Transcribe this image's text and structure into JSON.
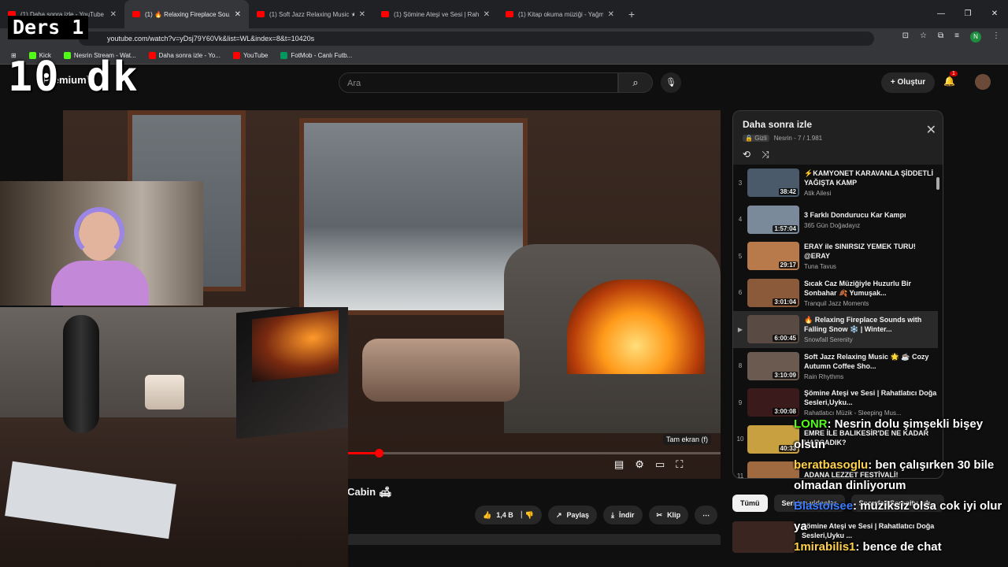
{
  "browser": {
    "tabs": [
      {
        "label": "(1) Daha sonra izle - YouTube",
        "active": false
      },
      {
        "label": "(1) 🔥 Relaxing Fireplace Sou...",
        "active": true
      },
      {
        "label": "(1) Soft Jazz Relaxing Music ★...",
        "active": false
      },
      {
        "label": "(1) Şömine Ateşi ve Sesi | Rahat...",
        "active": false
      },
      {
        "label": "(1) Kitap okuma müziği - Yağmu...",
        "active": false
      }
    ],
    "new_tab": "+",
    "url": "youtube.com/watch?v=yDsj79Y60Vk&list=WL&index=8&t=10420s",
    "profile_initial": "N",
    "bookmarks": [
      {
        "label": "Kick",
        "color": "#53fc18"
      },
      {
        "label": "Nesrin Stream - Wat...",
        "color": "#53fc18"
      },
      {
        "label": "Daha sonra izle - Yo...",
        "color": "#ff0000"
      },
      {
        "label": "YouTube",
        "color": "#ff0000"
      },
      {
        "label": "FotMob - Canlı Futb...",
        "color": "#00985f"
      }
    ]
  },
  "youtube": {
    "logo": "Premium",
    "logo_region": "TR",
    "search_placeholder": "Ara",
    "create_label": "Oluştur",
    "notif_count": "1"
  },
  "video": {
    "tooltip": "Tam ekran (f)",
    "progress": 0.48,
    "title": "Cabin 🛋",
    "likes": "1,4 B",
    "share": "Paylaş",
    "download": "İndir",
    "clip": "Klip",
    "more": "⋯"
  },
  "playlist": {
    "title": "Daha sonra izle",
    "privacy": "Gizli",
    "owner": "Nesrin - 7 / 1.981",
    "items": [
      {
        "index": "3",
        "title": "⚡KAMYONET KARAVANLA ŞİDDETLİ YAĞIŞTA KAMP",
        "channel": "Atik Ailesi",
        "duration": "38:42",
        "thumb": "#4a5a6a",
        "now": false
      },
      {
        "index": "4",
        "title": "3 Farklı Dondurucu Kar Kampı",
        "channel": "365 Gün Doğadayız",
        "duration": "1:57:04",
        "thumb": "#7a8a9a",
        "now": false
      },
      {
        "index": "5",
        "title": "ERAY ile SINIRSIZ YEMEK TURU! @ERAY",
        "channel": "Tuna Tavus",
        "duration": "29:17",
        "thumb": "#b87a4a",
        "now": false
      },
      {
        "index": "6",
        "title": "Sıcak Caz Müziğiyle Huzurlu Bir Sonbahar 🍂 Yumuşak...",
        "channel": "Tranquil Jazz Moments",
        "duration": "3:01:04",
        "thumb": "#8a5a3a",
        "now": false
      },
      {
        "index": "▶",
        "title": "🔥 Relaxing Fireplace Sounds with Falling Snow ❄️ | Winter...",
        "channel": "Snowfall Serenity",
        "duration": "6:00:45",
        "thumb": "#5a4a44",
        "now": true
      },
      {
        "index": "8",
        "title": "Soft Jazz Relaxing Music 🌟 ☕ Cozy Autumn Coffee Sho...",
        "channel": "Rain Rhythms",
        "duration": "3:10:09",
        "thumb": "#6a5a50",
        "now": false
      },
      {
        "index": "9",
        "title": "Şömine Ateşi ve Sesi | Rahatlatıcı Doğa Sesleri,Uyku...",
        "channel": "Rahatlatıcı Müzik - Sleeping Mus...",
        "duration": "3:00:08",
        "thumb": "#3a1a1a",
        "now": false
      },
      {
        "index": "10",
        "title": "EMRE İLE BALIKESİR'DE NE KADAR HARCADIK?",
        "channel": "",
        "duration": "40:33",
        "thumb": "#c8a040",
        "now": false
      },
      {
        "index": "11",
        "title": "ADANA LEZZET FESTİVALİ!",
        "channel": "",
        "duration": "18:13",
        "thumb": "#a06a40",
        "now": false
      }
    ]
  },
  "chips": [
    {
      "label": "Tümü",
      "on": true
    },
    {
      "label": "Seriden videolar",
      "on": false
    },
    {
      "label": "Snowfall Serenity adı...",
      "on": false
    }
  ],
  "recommended": {
    "title": "Şömine Ateşi ve Sesi | Rahatlatıcı Doğa Sesleri,Uyku ..."
  },
  "overlay": {
    "title": "Ders 1",
    "timer": "10 dk"
  },
  "chat": [
    {
      "user": "LONR",
      "user_color": "#53fc18",
      "message": ": Nesrin dolu şimşekli bişey olsun"
    },
    {
      "user": "beratbasoglu",
      "user_color": "#ffd24a",
      "message": ": ben çalışırken 30 bile olmadan dinliyorum"
    },
    {
      "user": "Blastoisee",
      "user_color": "#3a7bff",
      "message": ": müziksiz olsa cok iyi olur ya"
    },
    {
      "user": "1mirabilis1",
      "user_color": "#ffd24a",
      "message": ": bence de chat"
    }
  ]
}
